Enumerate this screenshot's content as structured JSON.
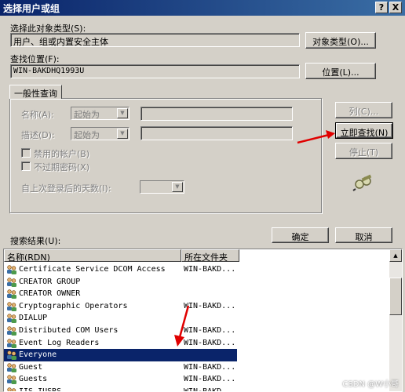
{
  "window": {
    "title": "选择用户或组",
    "help_label": "?",
    "close_label": "X"
  },
  "object_type": {
    "label": "选择此对象类型(S):",
    "value": "用户、组或内置安全主体",
    "button": "对象类型(O)..."
  },
  "location": {
    "label": "查找位置(F):",
    "value": "WIN-BAKDHQ1993U",
    "button": "位置(L)..."
  },
  "query": {
    "tab": "一般性查询",
    "name_label": "名称(A):",
    "name_mode": "起始为",
    "desc_label": "描述(D):",
    "desc_mode": "起始为",
    "disabled_accounts": "禁用的帐户(B)",
    "no_expire_password": "不过期密码(X)",
    "days_label": "自上次登录后的天数(I):"
  },
  "side_buttons": {
    "columns": "列(C)...",
    "find_now": "立即查找(N)",
    "stop": "停止(T)"
  },
  "results": {
    "label": "搜索结果(U):",
    "ok": "确定",
    "cancel": "取消",
    "col_name": "名称(RDN)",
    "col_folder": "所在文件夹",
    "rows": [
      {
        "name": "Certificate Service DCOM Access",
        "folder": "WIN-BAKD..."
      },
      {
        "name": "CREATOR GROUP",
        "folder": ""
      },
      {
        "name": "CREATOR OWNER",
        "folder": ""
      },
      {
        "name": "Cryptographic Operators",
        "folder": "WIN-BAKD..."
      },
      {
        "name": "DIALUP",
        "folder": ""
      },
      {
        "name": "Distributed COM Users",
        "folder": "WIN-BAKD..."
      },
      {
        "name": "Event Log Readers",
        "folder": "WIN-BAKD..."
      },
      {
        "name": "Everyone",
        "folder": ""
      },
      {
        "name": "Guest",
        "folder": "WIN-BAKD..."
      },
      {
        "name": "Guests",
        "folder": "WIN-BAKD..."
      },
      {
        "name": "IIS_IUSRS",
        "folder": "WIN-BAKD..."
      }
    ],
    "selected_index": 7
  },
  "watermark": "CSDN @W小哥",
  "colors": {
    "title_start": "#0a246a",
    "title_end": "#3a6ea5",
    "selection": "#0a246a",
    "arrow": "#e00000",
    "face": "#d4d0c8"
  },
  "icons": [
    "help-icon",
    "close-icon",
    "search-binoculars-icon",
    "user-group-icon",
    "annotation-arrow"
  ]
}
